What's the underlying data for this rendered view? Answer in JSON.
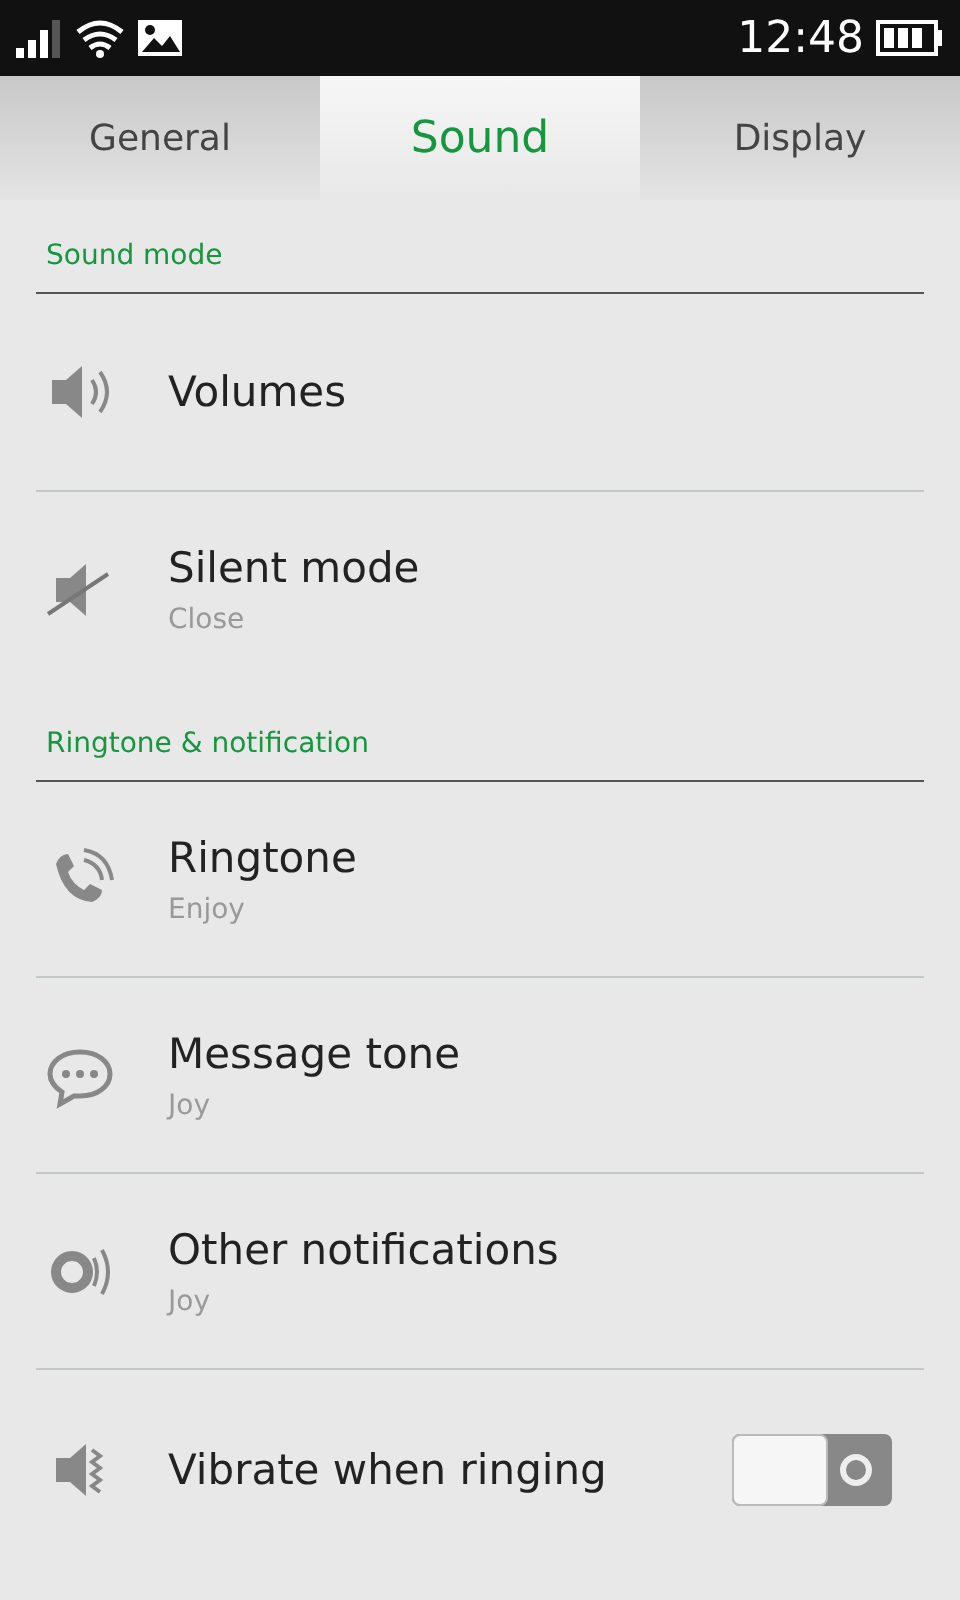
{
  "status_bar": {
    "time": "12:48"
  },
  "tabs": [
    {
      "label": "General",
      "selected": false
    },
    {
      "label": "Sound",
      "selected": true
    },
    {
      "label": "Display",
      "selected": false
    }
  ],
  "sections": [
    {
      "title": "Sound mode",
      "items": [
        {
          "kind": "volume",
          "title": "Volumes"
        },
        {
          "kind": "silent",
          "title": "Silent mode",
          "subtitle": "Close"
        }
      ]
    },
    {
      "title": "Ringtone & notification",
      "items": [
        {
          "kind": "ringtone",
          "title": "Ringtone",
          "subtitle": "Enjoy"
        },
        {
          "kind": "message",
          "title": "Message tone",
          "subtitle": "Joy"
        },
        {
          "kind": "notification",
          "title": "Other notifications",
          "subtitle": "Joy"
        },
        {
          "kind": "vibrate",
          "title": "Vibrate when ringing",
          "on": false
        }
      ]
    }
  ]
}
